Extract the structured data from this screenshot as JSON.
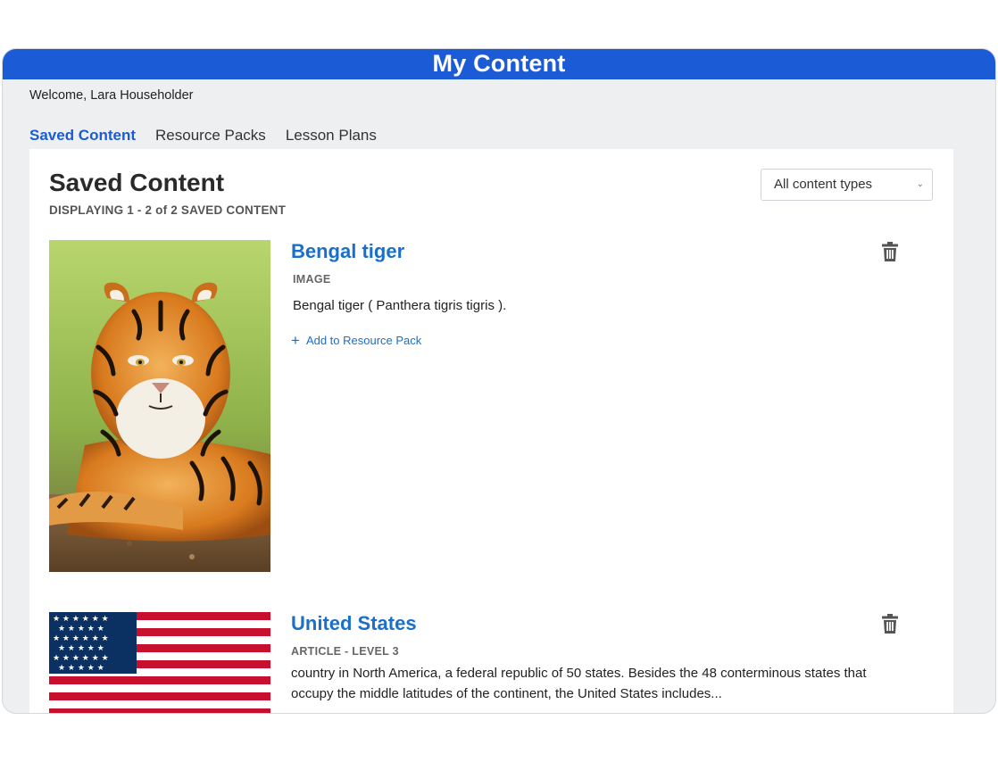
{
  "app": {
    "title": "My Content",
    "welcome": "Welcome, Lara Householder"
  },
  "tabs": [
    {
      "label": "Saved Content",
      "active": true
    },
    {
      "label": "Resource Packs",
      "active": false
    },
    {
      "label": "Lesson Plans",
      "active": false
    }
  ],
  "saved": {
    "heading": "Saved Content",
    "count_text": "DISPLAYING 1 - 2 of 2 SAVED CONTENT",
    "filter": {
      "selected": "All content types"
    },
    "items": [
      {
        "title": "Bengal tiger",
        "type": "IMAGE",
        "description": "Bengal tiger ( Panthera tigris tigris ).",
        "add_link": "Add to Resource Pack",
        "thumbnail": "tiger-photo"
      },
      {
        "title": "United States",
        "type": "ARTICLE - LEVEL 3",
        "description": "country in North America, a federal republic of 50 states. Besides the 48 conterminous states that occupy the middle latitudes of the continent, the United States includes...",
        "thumbnail": "us-flag"
      }
    ]
  },
  "icons": {
    "delete": "trash-icon",
    "add": "plus-icon",
    "dropdown": "chevron-down-icon"
  },
  "colors": {
    "brand": "#1b5bd6",
    "link": "#1a6fc9",
    "background": "#eeeff1"
  }
}
